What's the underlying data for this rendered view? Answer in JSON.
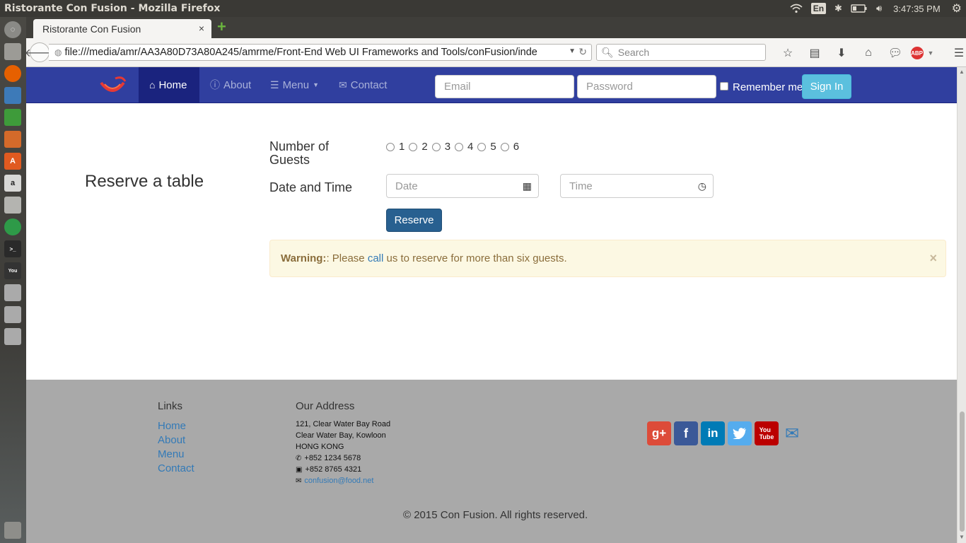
{
  "window": {
    "title": "Ristorante Con Fusion - Mozilla Firefox"
  },
  "tray": {
    "lang": "En",
    "clock": "3:47:35 PM"
  },
  "browser": {
    "tab_title": "Ristorante Con Fusion",
    "tab_close": "×",
    "new_tab": "+",
    "url": "file:///media/amr/AA3A80D73A80A245/amrme/Front-End Web UI Frameworks and Tools/conFusion/inde",
    "search_placeholder": "Search",
    "abp": "ABP"
  },
  "navbar": {
    "items": [
      {
        "label": "Home",
        "icon": "home-icon"
      },
      {
        "label": "About",
        "icon": "info-icon"
      },
      {
        "label": "Menu",
        "icon": "list-icon"
      },
      {
        "label": "Contact",
        "icon": "envelope-icon"
      }
    ],
    "email_placeholder": "Email",
    "password_placeholder": "Password",
    "remember_label": "Remember me",
    "signin_label": "Sign In"
  },
  "reservation": {
    "heading": "Reserve a table",
    "guests_label": "Number of Guests",
    "guests_options": [
      "1",
      "2",
      "3",
      "4",
      "5",
      "6"
    ],
    "datetime_label": "Date and Time",
    "date_placeholder": "Date",
    "time_placeholder": "Time",
    "reserve_label": "Reserve",
    "warning": {
      "strong": "Warning:",
      "text_before": ": Please ",
      "link": "call",
      "text_after": " us to reserve for more than six guests.",
      "close": "×"
    }
  },
  "footer": {
    "links_heading": "Links",
    "links": [
      "Home",
      "About",
      "Menu",
      "Contact"
    ],
    "address_heading": "Our Address",
    "address_lines": [
      "121, Clear Water Bay Road",
      "Clear Water Bay, Kowloon",
      "HONG KONG"
    ],
    "phone": "+852 1234 5678",
    "fax": "+852 8765 4321",
    "email": "confusion@food.net",
    "copyright": "© 2015 Con Fusion. All rights reserved."
  }
}
